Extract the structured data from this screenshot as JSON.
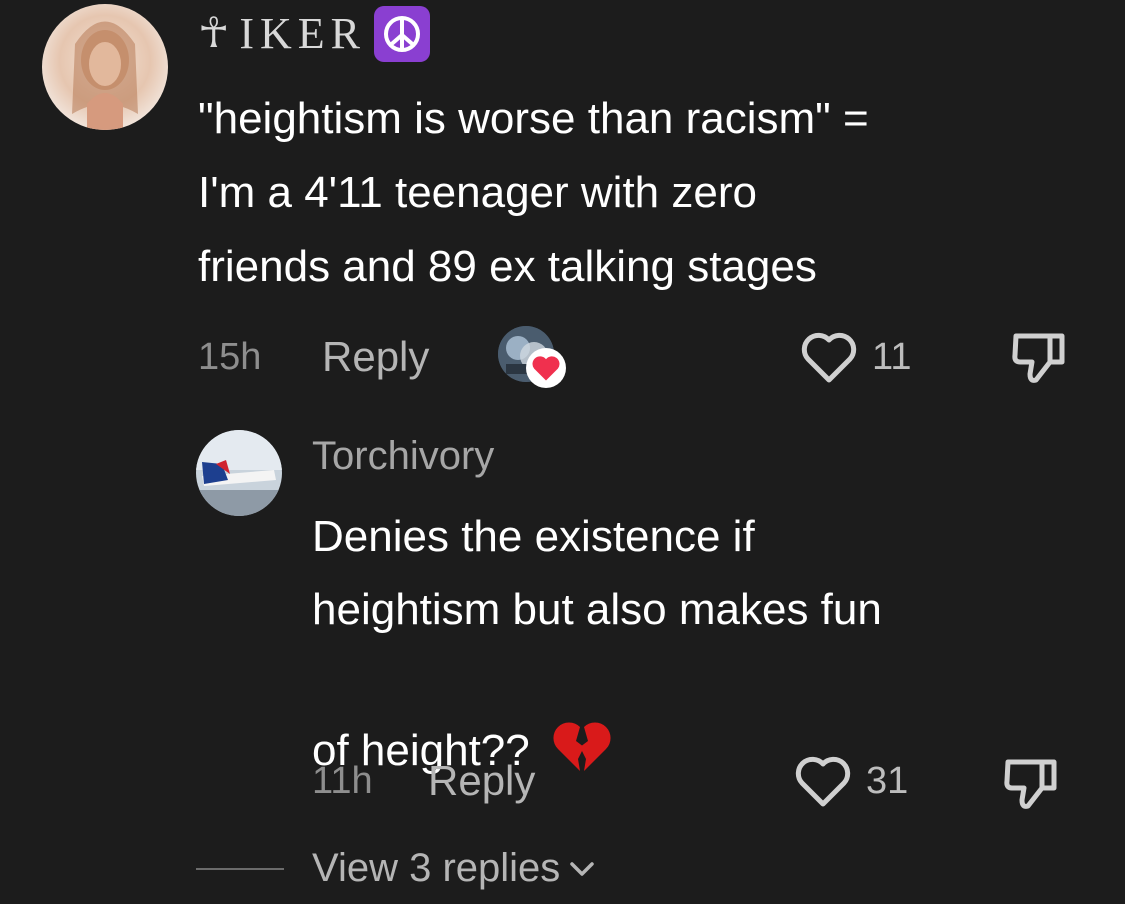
{
  "comment": {
    "username": "IKER",
    "username_prefix_symbol": "ankh",
    "username_suffix_emoji": "peace-symbol",
    "text": "\"heightism is worse than racism\" =\nI'm a 4'11 teenager with zero\nfriends and 89 ex talking stages",
    "time": "15h",
    "reply_label": "Reply",
    "like_count": "11"
  },
  "reply": {
    "username": "Torchivory",
    "text": "Denies the existence if\nheightism but also makes fun\nof height??",
    "time": "11h",
    "reply_label": "Reply",
    "like_count": "31"
  },
  "view_replies_label": "View 3 replies",
  "colors": {
    "background": "#1c1c1c",
    "text": "#ffffff",
    "muted": "#8e8e8e",
    "peace_badge": "#8a3fd1",
    "heart_badge": "#f0304e"
  }
}
